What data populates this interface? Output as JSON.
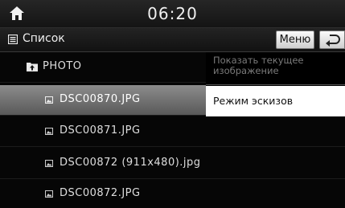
{
  "status_bar": {
    "time": "06:20",
    "home_icon": "home-icon"
  },
  "title_bar": {
    "list_label": "Список",
    "menu_label": "Меню",
    "back_icon": "back-arrow-icon"
  },
  "list": {
    "folder": {
      "label": "PHOTO",
      "icon": "folder-up-icon"
    },
    "items": [
      {
        "label": "DSC00870.JPG",
        "icon": "image-file-icon",
        "selected": true
      },
      {
        "label": "DSC00871.JPG",
        "icon": "image-file-icon"
      },
      {
        "label": "DSC00872 (911x480).jpg",
        "icon": "image-file-icon"
      },
      {
        "label": "DSC00872.JPG",
        "icon": "image-file-icon"
      }
    ]
  },
  "popup_menu": {
    "items": [
      {
        "label": "Показать текущее изображение",
        "enabled": false
      },
      {
        "label": "Режим эскизов",
        "enabled": true
      }
    ]
  }
}
